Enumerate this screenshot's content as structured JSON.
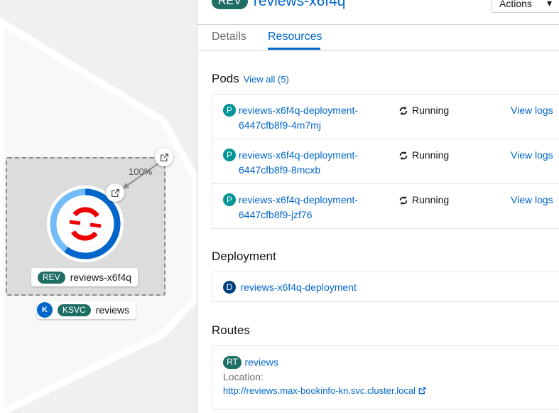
{
  "canvas": {
    "edge_percent": "100%",
    "revision_node": {
      "kind": "REV",
      "name": "reviews-x6f4q"
    },
    "service_node": {
      "icon_letter": "K",
      "kind": "KSVC",
      "name": "reviews"
    },
    "colors": {
      "rev_badge": "#1e6e64",
      "ring": "#0066cc",
      "ring_light": "#73bcf7",
      "logo": "#ee0000"
    }
  },
  "panel": {
    "title_badge": "REV",
    "title": "reviews-x6f4q",
    "actions_label": "Actions",
    "tabs": [
      {
        "label": "Details",
        "active": false
      },
      {
        "label": "Resources",
        "active": true
      }
    ],
    "pods": {
      "title": "Pods",
      "view_all": "View all (5)",
      "items": [
        {
          "badge": "P",
          "name_line1": "reviews-x6f4q-deployment-",
          "name_line2": "6447cfb8f9-4m7mj",
          "status": "Running",
          "logs": "View logs"
        },
        {
          "badge": "P",
          "name_line1": "reviews-x6f4q-deployment-",
          "name_line2": "6447cfb8f9-8mcxb",
          "status": "Running",
          "logs": "View logs"
        },
        {
          "badge": "P",
          "name_line1": "reviews-x6f4q-deployment-",
          "name_line2": "6447cfb8f9-jzf76",
          "status": "Running",
          "logs": "View logs"
        }
      ]
    },
    "deployment": {
      "title": "Deployment",
      "badge": "D",
      "name": "reviews-x6f4q-deployment"
    },
    "routes": {
      "title": "Routes",
      "badge": "RT",
      "name": "reviews",
      "location_label": "Location:",
      "url": "http://reviews.max-bookinfo-kn.svc.cluster.local"
    }
  }
}
